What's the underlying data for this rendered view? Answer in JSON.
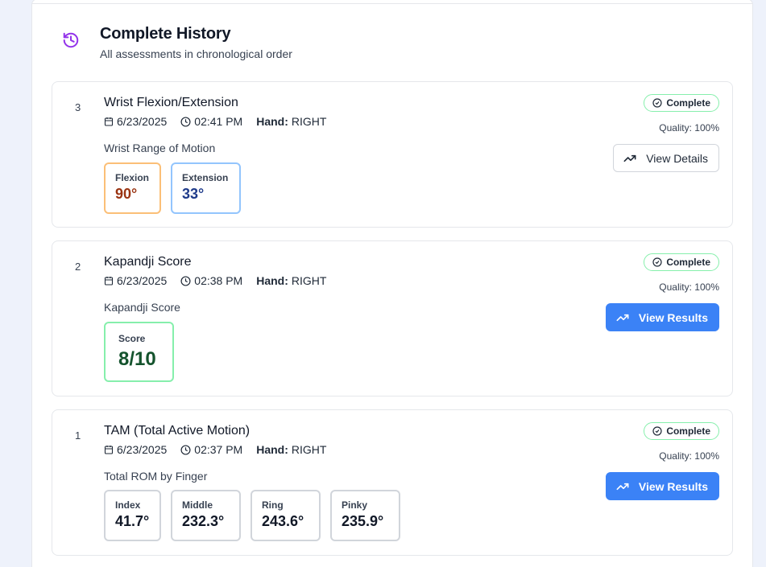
{
  "header": {
    "icon": "history-icon",
    "title": "Complete History",
    "subtitle": "All assessments in chronological order"
  },
  "colors": {
    "accent_purple": "#9333ea",
    "primary_blue": "#3b82f6",
    "status_green": "#86efac",
    "flexion_border": "#fbbf77",
    "flexion_value": "#9a3412",
    "extension_border": "#93c5fd",
    "extension_value": "#1e3a8a",
    "score_border": "#86efac",
    "score_value": "#14532d"
  },
  "labels": {
    "hand": "Hand:"
  },
  "assessments": [
    {
      "number": "3",
      "title": "Wrist Flexion/Extension",
      "date": "6/23/2025",
      "time": "02:41 PM",
      "hand": "RIGHT",
      "section": "Wrist Range of Motion",
      "status": "Complete",
      "quality": "Quality: 100%",
      "button": "View Details",
      "metrics": [
        {
          "label": "Flexion",
          "value": "90°"
        },
        {
          "label": "Extension",
          "value": "33°"
        }
      ]
    },
    {
      "number": "2",
      "title": "Kapandji Score",
      "date": "6/23/2025",
      "time": "02:38 PM",
      "hand": "RIGHT",
      "section": "Kapandji Score",
      "status": "Complete",
      "quality": "Quality: 100%",
      "button": "View Results",
      "metrics": [
        {
          "label": "Score",
          "value": "8/10"
        }
      ]
    },
    {
      "number": "1",
      "title": "TAM (Total Active Motion)",
      "date": "6/23/2025",
      "time": "02:37 PM",
      "hand": "RIGHT",
      "section": "Total ROM by Finger",
      "status": "Complete",
      "quality": "Quality: 100%",
      "button": "View Results",
      "metrics": [
        {
          "label": "Index",
          "value": "41.7°"
        },
        {
          "label": "Middle",
          "value": "232.3°"
        },
        {
          "label": "Ring",
          "value": "243.6°"
        },
        {
          "label": "Pinky",
          "value": "235.9°"
        }
      ]
    }
  ]
}
